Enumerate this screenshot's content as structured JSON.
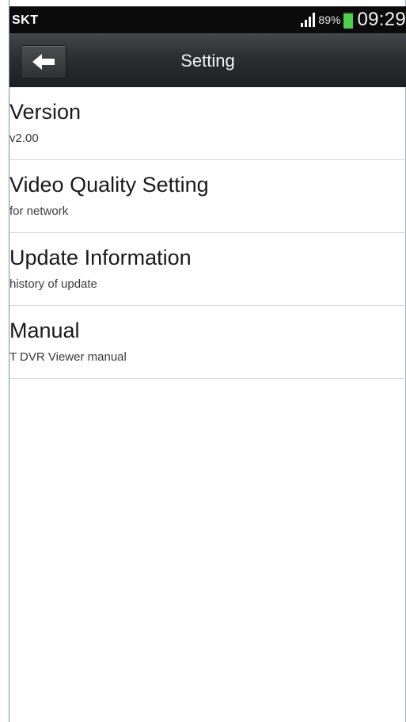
{
  "status_bar": {
    "carrier": "SKT",
    "battery_percent": "89%",
    "battery_level": 0.89,
    "time": "09:29",
    "signal_icon": "signal-bars-icon",
    "battery_icon": "battery-icon",
    "battery_color": "#4cd24c"
  },
  "action_bar": {
    "title": "Setting",
    "back_icon": "back-arrow-icon"
  },
  "settings": {
    "items": [
      {
        "title": "Version",
        "subtitle": "v2.00"
      },
      {
        "title": "Video Quality Setting",
        "subtitle": "for network"
      },
      {
        "title": "Update Information",
        "subtitle": "history of update"
      },
      {
        "title": "Manual",
        "subtitle": "T DVR Viewer manual"
      }
    ]
  }
}
